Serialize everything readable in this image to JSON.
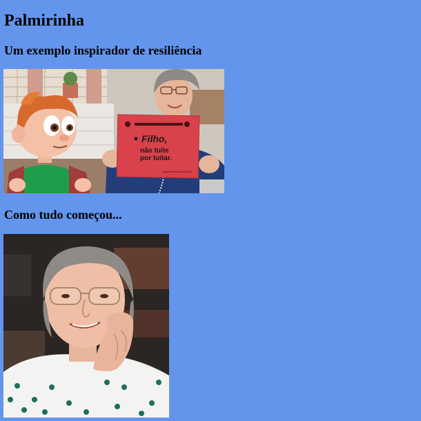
{
  "page": {
    "title": "Palmirinha",
    "subtitle": "Um exemplo inspirador de resiliência",
    "section_title": "Como tudo começou..."
  },
  "photo1": {
    "sign_line1": "Filho,",
    "sign_line2": "não tuíte",
    "sign_line3": "por tuitar.",
    "sign_small": "#aprendercomconoscoi"
  },
  "colors": {
    "background": "#6495ED",
    "sign_red": "#D9414B"
  }
}
